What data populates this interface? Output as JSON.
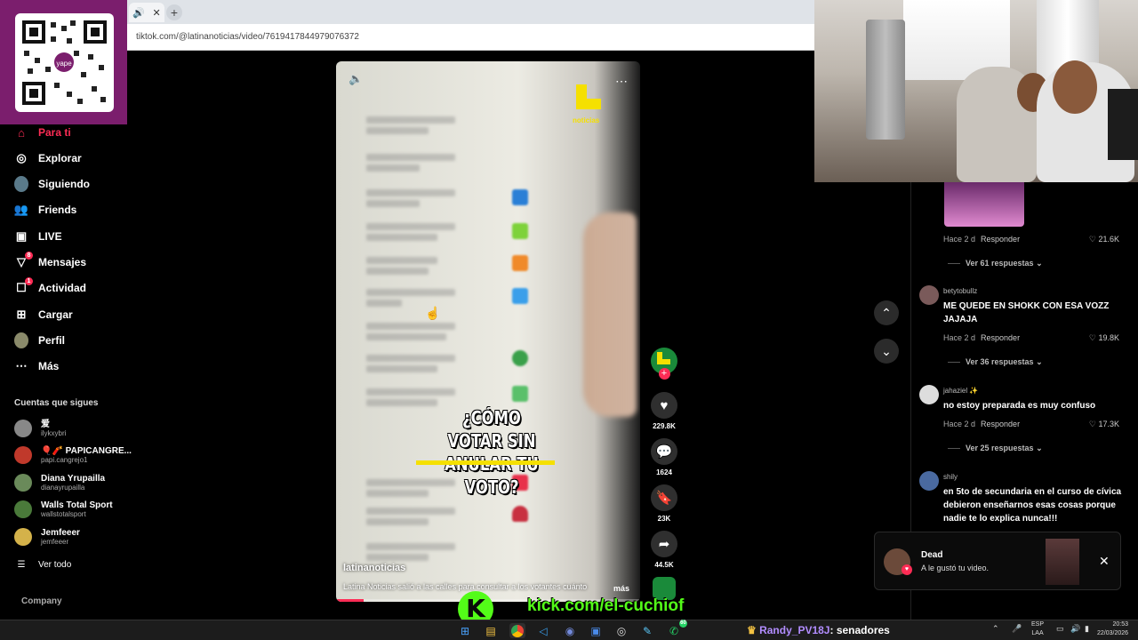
{
  "browser": {
    "tab_icons": [
      "speaker-icon",
      "close-icon"
    ],
    "url": "tiktok.com/@latinanoticias/video/7619417844979076372"
  },
  "sidebar": {
    "items": [
      {
        "label": "Para ti",
        "icon": "home-icon",
        "active": true
      },
      {
        "label": "Explorar",
        "icon": "compass-icon"
      },
      {
        "label": "Siguiendo",
        "icon": "avatar-icon"
      },
      {
        "label": "Friends",
        "icon": "friends-icon"
      },
      {
        "label": "LIVE",
        "icon": "live-icon"
      },
      {
        "label": "Mensajes",
        "icon": "send-icon",
        "badge": "8"
      },
      {
        "label": "Actividad",
        "icon": "activity-icon",
        "badge": "1"
      },
      {
        "label": "Cargar",
        "icon": "upload-icon"
      },
      {
        "label": "Perfil",
        "icon": "profile-icon"
      },
      {
        "label": "Más",
        "icon": "more-icon"
      }
    ],
    "following_title": "Cuentas que sigues",
    "accounts": [
      {
        "name": "爱",
        "handle": "ilykxybri",
        "color": "#888"
      },
      {
        "name": "🎈🧨 PAPICANGRE...",
        "handle": "papi.cangrejo1",
        "color": "#c0392b"
      },
      {
        "name": "Diana Yrupailla",
        "handle": "dianayrupailla",
        "color": "#6a8a5a"
      },
      {
        "name": "Walls Total Sport",
        "handle": "wallstotalsport",
        "color": "#4a7a3a"
      },
      {
        "name": "Jemfeeer",
        "handle": "jemfeeer",
        "color": "#d4b24a"
      }
    ],
    "see_all": "Ver todo",
    "company": "Company"
  },
  "video": {
    "overlay_title": "¿CÓMO VOTAR SIN ANULAR TU VOTO?",
    "logo_text": "noticias",
    "author": "latinanoticias",
    "caption": "Latina Noticias salió a las calles para consultar a los votantes cuánto",
    "more": "más",
    "progress": 0.09
  },
  "actions": [
    {
      "name": "like",
      "icon": "heart-icon",
      "count": "229.8K"
    },
    {
      "name": "comment",
      "icon": "comment-icon",
      "count": "1624"
    },
    {
      "name": "save",
      "icon": "bookmark-icon",
      "count": "23K"
    },
    {
      "name": "share",
      "icon": "share-icon",
      "count": "44.5K"
    }
  ],
  "comments": {
    "first_meta": {
      "time": "Hace 2 d",
      "reply": "Responder",
      "likes": "21.6K"
    },
    "first_more": "Ver 61 respuestas",
    "items": [
      {
        "user": "betytobullz",
        "text": "ME QUEDE EN SHOKK CON ESA VOZZ JAJAJA",
        "time": "Hace 2 d",
        "reply": "Responder",
        "likes": "19.8K",
        "more": "Ver 36 respuestas",
        "color": "#7a5a5a"
      },
      {
        "user": "jahaziel ✨",
        "text": "no estoy preparada es muy confuso",
        "time": "Hace 2 d",
        "reply": "Responder",
        "likes": "17.3K",
        "more": "Ver 25 respuestas",
        "color": "#ddd"
      },
      {
        "user": "shily",
        "text": "en 5to de secundaria en el curso de cívica debieron enseñarnos esas cosas porque nadie te lo explica nunca!!!",
        "color": "#4a6aa0"
      }
    ]
  },
  "notification": {
    "title": "Dead",
    "subtitle": "A le gustó tu video."
  },
  "stream": {
    "kick_url": "kick.com/el-cuchiof",
    "chat_user": "Randy_PV18J",
    "chat_msg": ": senadores"
  },
  "taskbar": {
    "lang_top": "ESP",
    "lang_bottom": "LAA",
    "time": "20:53",
    "date": "22/03/2026",
    "whatsapp_badge": "60"
  }
}
